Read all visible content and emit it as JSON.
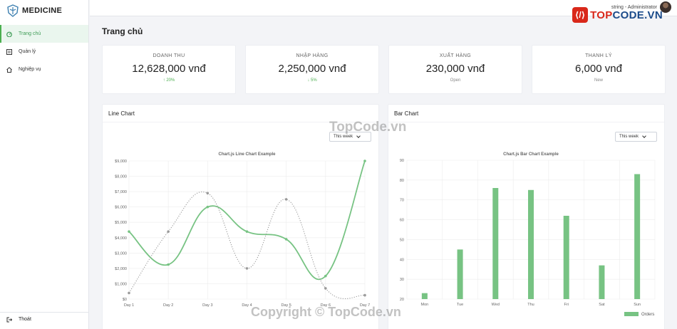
{
  "brand": {
    "name": "MEDICINE"
  },
  "sidebar": {
    "items": [
      {
        "label": "Trang chủ",
        "icon": "dashboard-icon"
      },
      {
        "label": "Quản lý",
        "icon": "list-icon"
      },
      {
        "label": "Nghiệp vụ",
        "icon": "home-icon"
      }
    ],
    "logout_label": "Thoát"
  },
  "user": {
    "label": "string - Administrator"
  },
  "watermark": {
    "logo_text_a": "TOP",
    "logo_text_b": "CODE.VN",
    "center": "TopCode.vn",
    "footer": "Copyright © TopCode.vn"
  },
  "page": {
    "title": "Trang chủ"
  },
  "stats": [
    {
      "label": "DOANH THU",
      "value": "12,628,000 vnđ",
      "note": "↑ 20%"
    },
    {
      "label": "NHẬP HÀNG",
      "value": "2,250,000 vnđ",
      "note": "↓ 5%"
    },
    {
      "label": "XUẤT HÀNG",
      "value": "230,000 vnđ",
      "note": "Open"
    },
    {
      "label": "THANH LÝ",
      "value": "6,000 vnđ",
      "note": "New"
    }
  ],
  "panels": {
    "line": {
      "title": "Line Chart",
      "select": "This week"
    },
    "bar": {
      "title": "Bar Chart",
      "select": "This week"
    }
  },
  "chart_data": [
    {
      "type": "line",
      "title": "Chart.js Line Chart Example",
      "categories": [
        "Day 1",
        "Day 2",
        "Day 3",
        "Day 4",
        "Day 5",
        "Day 6",
        "Day 7"
      ],
      "ylim": [
        0,
        9000
      ],
      "yticks": [
        "$0",
        "$1,000",
        "$2,000",
        "$3,000",
        "$4,000",
        "$5,000",
        "$6,000",
        "$7,000",
        "$8,000",
        "$9,000"
      ],
      "series": [
        {
          "values": [
            4400,
            2250,
            6000,
            4400,
            3900,
            1500,
            9000
          ],
          "color": "#77c383",
          "style": "solid"
        },
        {
          "values": [
            400,
            4400,
            6900,
            2000,
            6500,
            700,
            250
          ],
          "color": "#9a9a9a",
          "style": "dotted"
        }
      ],
      "grid": true
    },
    {
      "type": "bar",
      "title": "Chart.js Bar Chart Example",
      "categories": [
        "Mon",
        "Tue",
        "Wed",
        "Thu",
        "Fri",
        "Sat",
        "Sun"
      ],
      "ylim": [
        20,
        90
      ],
      "yticks": [
        "20",
        "30",
        "40",
        "50",
        "60",
        "70",
        "80",
        "90"
      ],
      "series": [
        {
          "name": "Orders",
          "values": [
            23,
            45,
            76,
            75,
            62,
            37,
            83
          ],
          "color": "#77c383"
        }
      ],
      "legend": "bottom-right",
      "grid": true
    }
  ]
}
